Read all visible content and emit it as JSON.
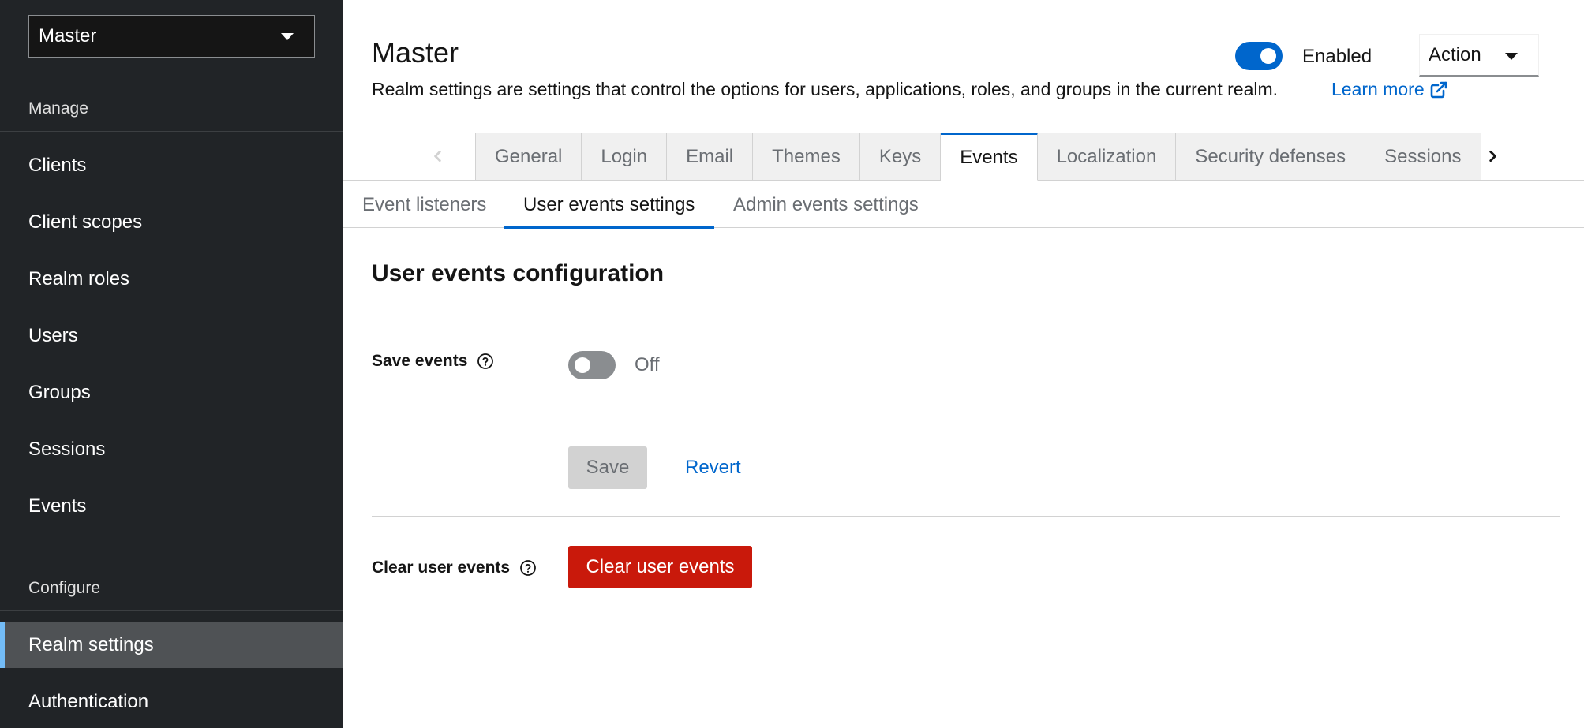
{
  "sidebar": {
    "realm_selector": "Master",
    "sections": {
      "manage": "Manage",
      "configure": "Configure"
    },
    "manage_items": [
      "Clients",
      "Client scopes",
      "Realm roles",
      "Users",
      "Groups",
      "Sessions",
      "Events"
    ],
    "configure_items": [
      "Realm settings",
      "Authentication"
    ],
    "active_item": "Realm settings"
  },
  "header": {
    "title": "Master",
    "description": "Realm settings are settings that control the options for users, applications, roles, and groups in the current realm.",
    "learn_more": "Learn more",
    "enabled_label": "Enabled",
    "enabled": true,
    "action_label": "Action"
  },
  "tabs": [
    "General",
    "Login",
    "Email",
    "Themes",
    "Keys",
    "Events",
    "Localization",
    "Security defenses",
    "Sessions"
  ],
  "active_tab": "Events",
  "subtabs": [
    "Event listeners",
    "User events settings",
    "Admin events settings"
  ],
  "active_subtab": "User events settings",
  "content": {
    "section_title": "User events configuration",
    "save_events_label": "Save events",
    "save_events_state": "Off",
    "save_button": "Save",
    "revert_button": "Revert",
    "clear_label": "Clear user events",
    "clear_button": "Clear user events"
  },
  "colors": {
    "sidebar_bg": "#212427",
    "active_nav_bg": "#4f5255",
    "active_nav_accent": "#73bcf7",
    "link_blue": "#0066cc",
    "danger_red": "#c9190b"
  },
  "icons": {
    "realm_caret": "caret-down-icon",
    "action_caret": "caret-down-icon",
    "learn_more": "external-link-icon",
    "tab_left": "chevron-left-icon",
    "tab_right": "chevron-right-icon",
    "help": "question-circle-icon"
  }
}
